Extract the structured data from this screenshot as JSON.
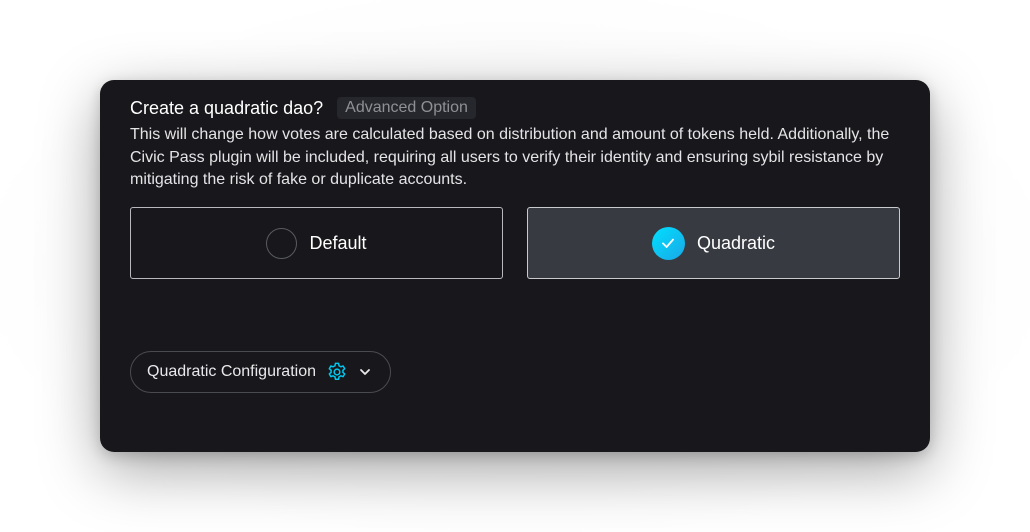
{
  "dialog": {
    "title": "Create a quadratic dao?",
    "badge": "Advanced Option",
    "description": "This will change how votes are calculated based on distribution and amount of tokens held. Additionally, the Civic Pass plugin will be included, requiring all users to verify their identity and ensuring sybil resistance by mitigating the risk of fake or duplicate accounts."
  },
  "options": [
    {
      "label": "Default",
      "selected": false
    },
    {
      "label": "Quadratic",
      "selected": true
    }
  ],
  "config": {
    "label": "Quadratic Configuration",
    "icon": "gear-icon",
    "chevron": "chevron-down-icon",
    "expanded": false
  },
  "colors": {
    "card_bg": "#18181c",
    "selected_bg": "#373a41",
    "accent": "#00c8f0",
    "accent_gradient_start": "#00e0ff",
    "accent_gradient_end": "#1aa7e6"
  }
}
